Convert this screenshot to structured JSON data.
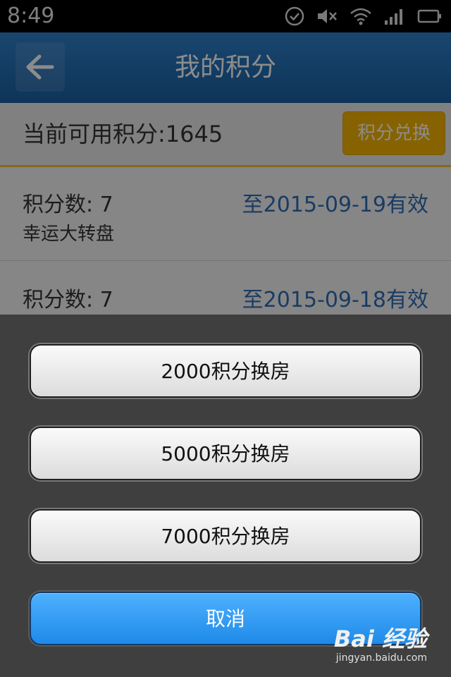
{
  "status_bar": {
    "time": "8:49",
    "icons": [
      "check-circle-icon",
      "mute-icon",
      "wifi-icon",
      "signal-icon",
      "battery-icon"
    ]
  },
  "header": {
    "title": "我的积分",
    "back_icon": "arrow-left-icon"
  },
  "points": {
    "label": "当前可用积分:1645",
    "exchange_label": "积分兑换"
  },
  "list": [
    {
      "points": "积分数: 7",
      "expire": "至2015-09-19有效",
      "source": "幸运大转盘"
    },
    {
      "points": "积分数: 7",
      "expire": "至2015-09-18有效"
    }
  ],
  "action_sheet": {
    "options": [
      "2000积分换房",
      "5000积分换房",
      "7000积分换房"
    ],
    "cancel_label": "取消"
  },
  "watermark": {
    "logo": "Bai 经验",
    "url": "jingyan.baidu.com"
  },
  "colors": {
    "header_blue": "#1a5fa3",
    "exchange_yellow": "#f5b400",
    "expire_blue": "#2e6cb5",
    "cancel_blue": "#1e8ae8"
  }
}
